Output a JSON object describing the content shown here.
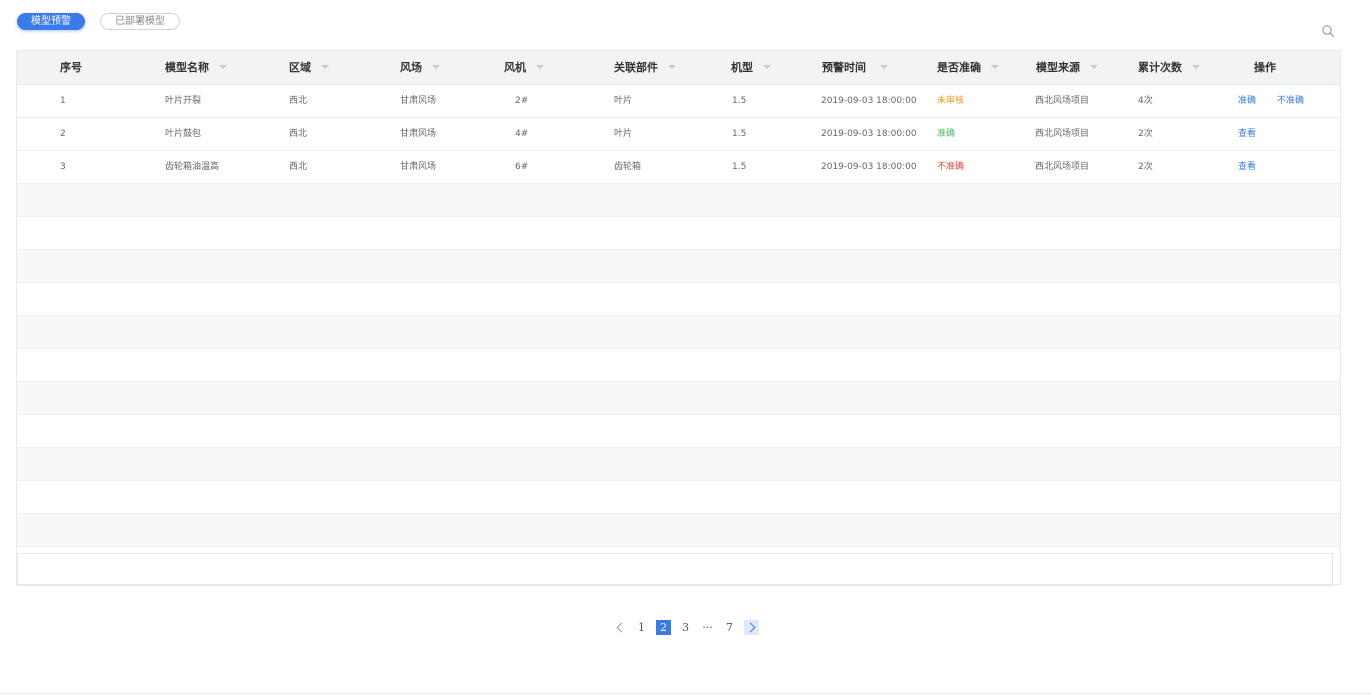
{
  "tabs": [
    {
      "label": "模型预警",
      "active": true
    },
    {
      "label": "已部署模型",
      "active": false
    }
  ],
  "table": {
    "headers": [
      "序号",
      "模型名称",
      "区域",
      "风场",
      "风机",
      "关联部件",
      "机型",
      "预警时间",
      "是否准确",
      "模型来源",
      "累计次数",
      "操作"
    ],
    "rows": [
      {
        "index": "1",
        "name": "叶片开裂",
        "region": "西北",
        "farm": "甘肃风场",
        "turbine": "2#",
        "part": "叶片",
        "model": "1.5",
        "time": "2019-09-03  18:00:00",
        "accuracy": "未审核",
        "accuracy_status": "pending",
        "source": "西北风场项目",
        "count": "4次",
        "actions": [
          "准确",
          "不准确"
        ]
      },
      {
        "index": "2",
        "name": "叶片鼓包",
        "region": "西北",
        "farm": "甘肃风场",
        "turbine": "4#",
        "part": "叶片",
        "model": "1.5",
        "time": "2019-09-03  18:00:00",
        "accuracy": "准确",
        "accuracy_status": "ok",
        "source": "西北风场项目",
        "count": "2次",
        "actions": [
          "查看"
        ]
      },
      {
        "index": "3",
        "name": "齿轮箱油温高",
        "region": "西北",
        "farm": "甘肃风场",
        "turbine": "6#",
        "part": "齿轮箱",
        "model": "1.5",
        "time": "2019-09-03  18:00:00",
        "accuracy": "不准确",
        "accuracy_status": "bad",
        "source": "西北风场项目",
        "count": "2次",
        "actions": [
          "查看"
        ]
      }
    ]
  },
  "pagination": {
    "pages": [
      "1",
      "2",
      "3",
      "···",
      "7"
    ],
    "current": "2"
  },
  "colors": {
    "accent": "#3a7be8",
    "pending": "#f0a020",
    "ok": "#4cb860",
    "bad": "#e8463c"
  }
}
